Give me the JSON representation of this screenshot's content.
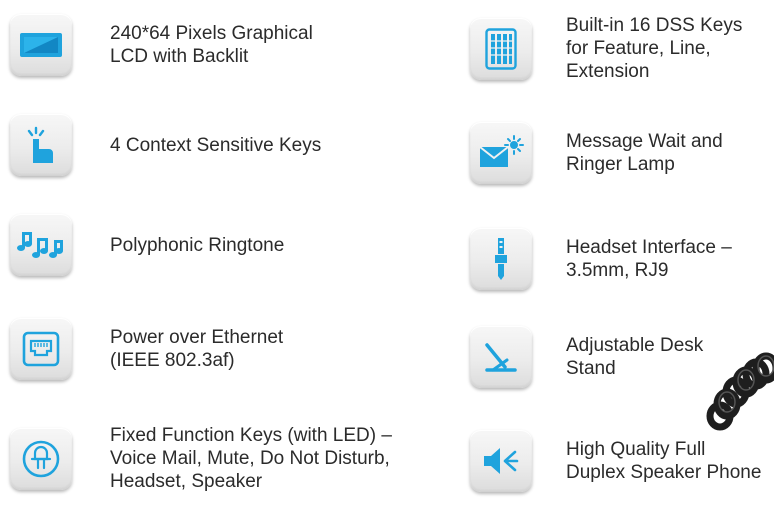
{
  "features_left": [
    {
      "icon": "lcd-display-icon",
      "label": "240*64 Pixels Graphical\nLCD with Backlit"
    },
    {
      "icon": "finger-tap-icon",
      "label": "4 Context Sensitive Keys"
    },
    {
      "icon": "music-notes-icon",
      "label": "Polyphonic Ringtone"
    },
    {
      "icon": "ethernet-port-icon",
      "label": "Power over Ethernet\n(IEEE 802.3af)"
    },
    {
      "icon": "function-key-icon",
      "label": "Fixed Function Keys (with LED) –\nVoice Mail, Mute, Do Not Disturb,\nHeadset, Speaker"
    }
  ],
  "features_right": [
    {
      "icon": "dss-keys-icon",
      "label": "Built-in 16 DSS Keys\nfor Feature, Line,\nExtension"
    },
    {
      "icon": "message-lamp-icon",
      "label": "Message Wait and\nRinger Lamp"
    },
    {
      "icon": "headset-jack-icon",
      "label": "Headset Interface –\n3.5mm, RJ9"
    },
    {
      "icon": "desk-stand-icon",
      "label": "Adjustable Desk\nStand"
    },
    {
      "icon": "speaker-icon",
      "label": "High Quality Full\nDuplex Speaker Phone"
    }
  ],
  "colors": {
    "icon_blue": "#1fa3dd",
    "tile_light": "#f4f4f4",
    "text": "#2b2b2b"
  }
}
